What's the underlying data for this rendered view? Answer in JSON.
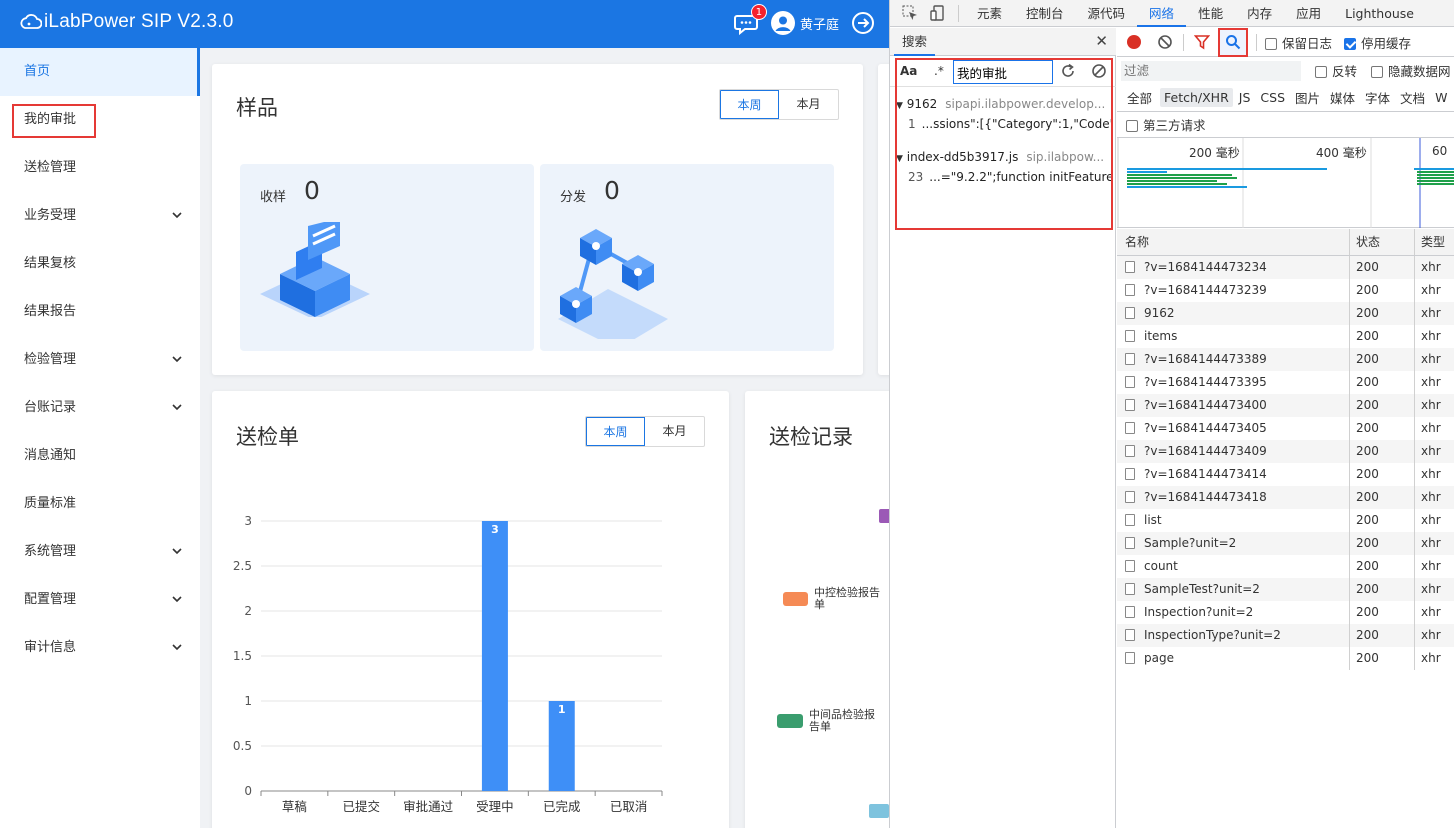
{
  "app": {
    "title": "iLabPower SIP V2.3.0",
    "notification_count": "1",
    "user_name": "黄子庭",
    "brand_color": "#1b76e3"
  },
  "sidebar": {
    "items": [
      {
        "label": "首页"
      },
      {
        "label": "我的审批"
      },
      {
        "label": "送检管理"
      },
      {
        "label": "业务受理"
      },
      {
        "label": "结果复核"
      },
      {
        "label": "结果报告"
      },
      {
        "label": "检验管理"
      },
      {
        "label": "台账记录"
      },
      {
        "label": "消息通知"
      },
      {
        "label": "质量标准"
      },
      {
        "label": "系统管理"
      },
      {
        "label": "配置管理"
      },
      {
        "label": "审计信息"
      }
    ]
  },
  "samples_card": {
    "title": "样品",
    "toggle": [
      "本周",
      "本月"
    ],
    "tiles": [
      {
        "label": "收样",
        "value": "0"
      },
      {
        "label": "分发",
        "value": "0"
      }
    ]
  },
  "inspection_card": {
    "title": "送检单",
    "toggle": [
      "本周",
      "本月"
    ]
  },
  "records_card": {
    "title": "送检记录",
    "legend": [
      {
        "label": "中控检验报告单",
        "color": "#f58a55"
      },
      {
        "label": "中间品检验报告单",
        "color": "#3a9d6e"
      }
    ]
  },
  "chart_data": {
    "type": "bar",
    "categories": [
      "草稿",
      "已提交",
      "审批通过",
      "受理中",
      "已完成",
      "已取消"
    ],
    "values": [
      0,
      0,
      0,
      3,
      1,
      0
    ],
    "ylim": [
      0,
      3
    ],
    "yticks": [
      "0",
      "0.5",
      "1",
      "1.5",
      "2",
      "2.5",
      "3"
    ],
    "bar_color": "#3e8ff7",
    "grid": true
  },
  "devtools": {
    "tabs": [
      "元素",
      "控制台",
      "源代码",
      "网络",
      "性能",
      "内存",
      "应用",
      "Lighthouse"
    ],
    "selected_tab": "网络",
    "search": {
      "tab_label": "搜索",
      "case_label": "Aa",
      "regex_label": ".*",
      "query": "我的审批",
      "results": [
        {
          "file": "9162",
          "host": "sipapi.ilabpower.develop...",
          "line_no": "1",
          "snippet": "...ssions\":[{\"Category\":1,\"Code\":..."
        },
        {
          "file": "index-dd5b3917.js",
          "host": "sip.ilabpow...",
          "line_no": "23",
          "snippet": "...=\"9.2.2\";function initFeature..."
        }
      ]
    },
    "network": {
      "preserve_log": "保留日志",
      "disable_cache": "停用缓存",
      "filter_placeholder": "过滤",
      "invert": "反转",
      "hide_data_urls": "隐藏数据网",
      "type_filters": [
        "全部",
        "Fetch/XHR",
        "JS",
        "CSS",
        "图片",
        "媒体",
        "字体",
        "文档",
        "W"
      ],
      "selected_type": "Fetch/XHR",
      "third_party": "第三方请求",
      "timeline_ticks": [
        "200 毫秒",
        "400 毫秒",
        "60"
      ],
      "columns": [
        "名称",
        "状态",
        "类型"
      ],
      "requests": [
        {
          "name": "?v=1684144473234",
          "status": "200",
          "type": "xhr"
        },
        {
          "name": "?v=1684144473239",
          "status": "200",
          "type": "xhr"
        },
        {
          "name": "9162",
          "status": "200",
          "type": "xhr"
        },
        {
          "name": "items",
          "status": "200",
          "type": "xhr"
        },
        {
          "name": "?v=1684144473389",
          "status": "200",
          "type": "xhr"
        },
        {
          "name": "?v=1684144473395",
          "status": "200",
          "type": "xhr"
        },
        {
          "name": "?v=1684144473400",
          "status": "200",
          "type": "xhr"
        },
        {
          "name": "?v=1684144473405",
          "status": "200",
          "type": "xhr"
        },
        {
          "name": "?v=1684144473409",
          "status": "200",
          "type": "xhr"
        },
        {
          "name": "?v=1684144473414",
          "status": "200",
          "type": "xhr"
        },
        {
          "name": "?v=1684144473418",
          "status": "200",
          "type": "xhr"
        },
        {
          "name": "list",
          "status": "200",
          "type": "xhr"
        },
        {
          "name": "Sample?unit=2",
          "status": "200",
          "type": "xhr"
        },
        {
          "name": "count",
          "status": "200",
          "type": "xhr"
        },
        {
          "name": "SampleTest?unit=2",
          "status": "200",
          "type": "xhr"
        },
        {
          "name": "Inspection?unit=2",
          "status": "200",
          "type": "xhr"
        },
        {
          "name": "InspectionType?unit=2",
          "status": "200",
          "type": "xhr"
        },
        {
          "name": "page",
          "status": "200",
          "type": "xhr"
        }
      ]
    }
  }
}
